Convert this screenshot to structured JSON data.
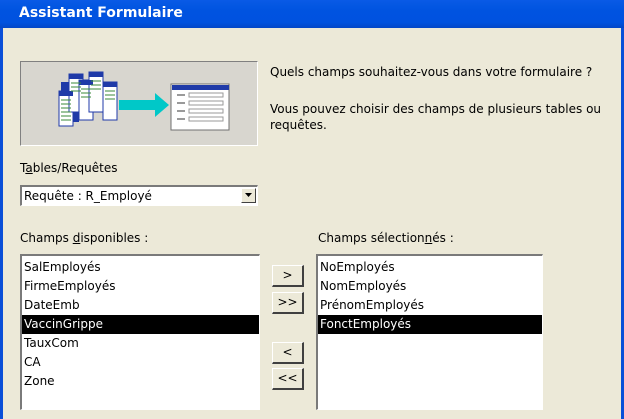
{
  "window": {
    "title": "Assistant Formulaire"
  },
  "intro": {
    "question": "Quels champs souhaitez-vous dans votre formulaire ?",
    "info_line1": "Vous pouvez choisir des champs de plusieurs tables ou",
    "info_line2": "requêtes."
  },
  "tables": {
    "label_pre": "T",
    "label_u": "a",
    "label_post": "bles/Requêtes",
    "selected": "Requête : R_Employé"
  },
  "available": {
    "label_pre": "Champs ",
    "label_u": "d",
    "label_post": "isponibles :",
    "items": [
      "SalEmployés",
      "FirmeEmployés",
      "DateEmb",
      "VaccinGrippe",
      "TauxCom",
      "CA",
      "Zone"
    ],
    "selected_index": 3
  },
  "selected_fields": {
    "label_pre": "Champs sélection",
    "label_u": "n",
    "label_post": "és :",
    "items": [
      "NoEmployés",
      "NomEmployés",
      "PrénomEmployés",
      "FonctEmployés"
    ],
    "selected_index": 3
  },
  "buttons": {
    "add_one": ">",
    "add_all": ">>",
    "remove_one": "<",
    "remove_all": "<<"
  },
  "icons": {
    "illustration": "form-wizard-illustration-icon",
    "dropdown": "chevron-down-icon"
  },
  "colors": {
    "titlebar": "#0053e0",
    "dialog_bg": "#ece9d8",
    "selection_bg": "#000000",
    "arrow": "#00c8c8"
  }
}
